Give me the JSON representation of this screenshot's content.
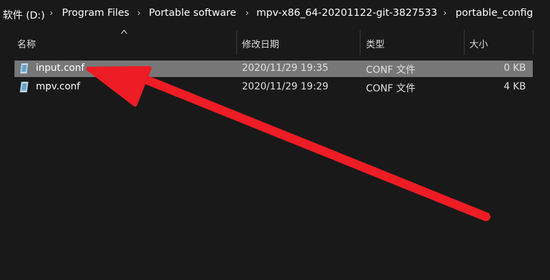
{
  "breadcrumb": {
    "items": [
      {
        "label": "软件 (D:)"
      },
      {
        "label": "Program Files"
      },
      {
        "label": "Portable software"
      },
      {
        "label": "mpv-x86_64-20201122-git-3827533"
      },
      {
        "label": "portable_config"
      }
    ]
  },
  "columns": {
    "name": "名称",
    "modified": "修改日期",
    "type": "类型",
    "size": "大小"
  },
  "files": [
    {
      "name": "input.conf",
      "modified": "2020/11/29 19:35",
      "type": "CONF 文件",
      "size": "0 KB",
      "selected": true,
      "icon": "conf-file-icon"
    },
    {
      "name": "mpv.conf",
      "modified": "2020/11/29 19:29",
      "type": "CONF 文件",
      "size": "4 KB",
      "selected": false,
      "icon": "conf-file-icon"
    }
  ],
  "colors": {
    "background": "#191919",
    "selection": "#777777",
    "annotation_arrow": "#ee1c24"
  }
}
